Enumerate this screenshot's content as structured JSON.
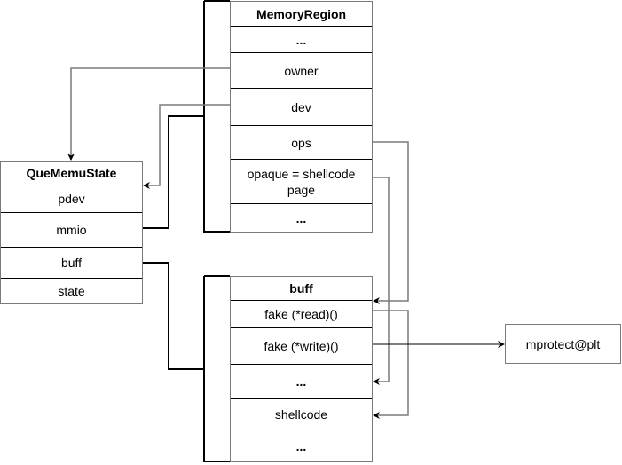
{
  "memory_region": {
    "title": "MemoryRegion",
    "fields": [
      "...",
      "owner",
      "dev",
      "ops",
      "opaque = shellcode page",
      "..."
    ]
  },
  "que_memu_state": {
    "title": "QueMemuState",
    "fields": [
      "pdev",
      "mmio",
      "buff",
      "state"
    ]
  },
  "buff": {
    "title": "buff",
    "fields": [
      "fake (*read)()",
      "fake (*write)()",
      "...",
      "shellcode",
      "..."
    ]
  },
  "mprotect": {
    "label": "mprotect@plt"
  },
  "colors": {
    "border": "#7a7a7a",
    "wire": "#7a7a7a",
    "bracket": "#000000"
  }
}
